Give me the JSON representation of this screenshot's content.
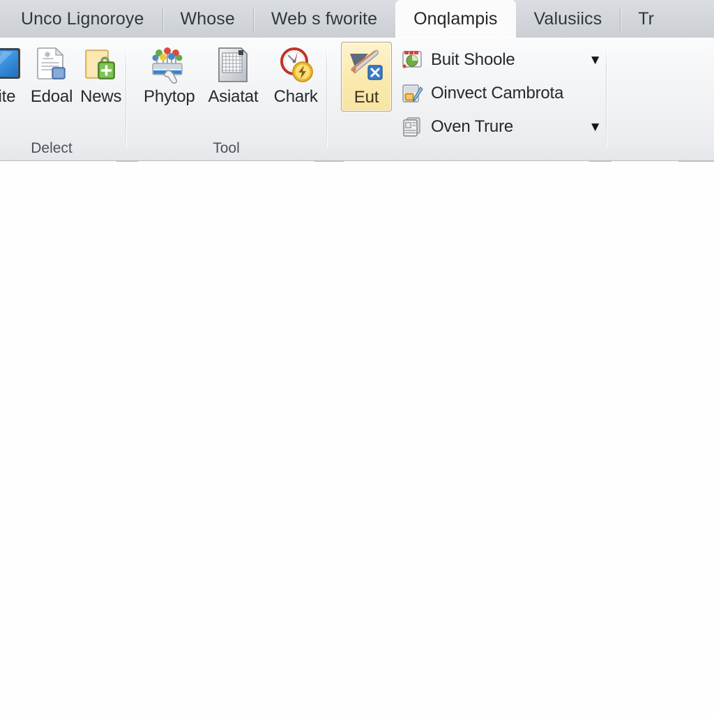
{
  "window": {
    "title": "Onqlampis"
  },
  "tabs": [
    {
      "label": "Unco Lignoroye",
      "active": false
    },
    {
      "label": "Whose",
      "active": false
    },
    {
      "label": "Web s fworite",
      "active": false
    },
    {
      "label": "Onqlampis",
      "active": true
    },
    {
      "label": "Valusiics",
      "active": false
    },
    {
      "label": "Tr",
      "active": false
    }
  ],
  "ribbon": {
    "groups": [
      {
        "name": "Delect",
        "label": "Delect",
        "buttons": [
          {
            "label": "aite",
            "icon": "monitor-screen-icon",
            "selected": false
          },
          {
            "label": "Edoal",
            "icon": "document-edit-icon",
            "selected": false
          },
          {
            "label": "News",
            "icon": "folder-lock-icon",
            "selected": false
          }
        ]
      },
      {
        "name": "Tool",
        "label": "Tool",
        "buttons": [
          {
            "label": "Phytop",
            "icon": "people-group-pointer-icon",
            "selected": false
          },
          {
            "label": "Asiatat",
            "icon": "grid-sheet-icon",
            "selected": false
          },
          {
            "label": "Chark",
            "icon": "gauge-lightning-icon",
            "selected": false
          }
        ]
      },
      {
        "name": "Onqlampis-actions",
        "label": "",
        "buttons": [
          {
            "label": "Eut",
            "icon": "brush-arrow-x-icon",
            "selected": true
          }
        ],
        "menu_items": [
          {
            "label": "Buit Shoole",
            "icon": "pie-chart-icon",
            "has_dropdown": true
          },
          {
            "label": "Oinvect Cambrota",
            "icon": "document-pen-icon",
            "has_dropdown": false
          },
          {
            "label": "Oven Trure",
            "icon": "document-stack-icon",
            "has_dropdown": true
          }
        ]
      },
      {
        "name": "empty-group",
        "label": "",
        "buttons": [],
        "menu_items": []
      }
    ]
  },
  "colors": {
    "tab_bar_bg": "#d4d8dc",
    "active_tab_bg": "#fbfbfc",
    "ribbon_bg": "#f1f3f5",
    "selected_button_bg": "#fbe9ae",
    "selected_button_border": "#b9a469",
    "content_bg": "#fefefe",
    "text_primary": "#25292d",
    "group_label_text": "#4c5257"
  },
  "content": {
    "body_text": ""
  }
}
